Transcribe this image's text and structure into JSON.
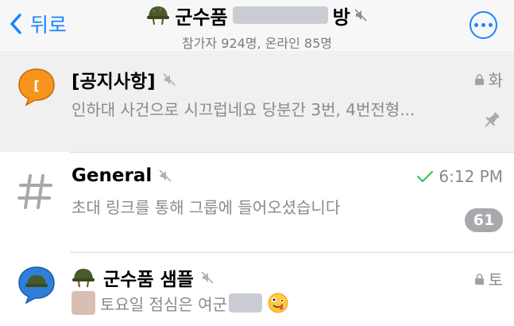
{
  "header": {
    "back_label": "뒤로",
    "title_prefix": "군수품",
    "title_suffix": "방",
    "subtitle": "참가자 924명, 온라인 85명"
  },
  "chats": [
    {
      "name": "[공지사항]",
      "preview": "인하대 사건으로 시끄럽네요 당분간 3번, 4번전형...",
      "time": "화",
      "status": "locked",
      "pinned": true
    },
    {
      "name": "General",
      "preview": "초대 링크를 통해 그룹에 들어오셨습니다",
      "time": "6:12 PM",
      "status": "read",
      "unread_count": "61"
    },
    {
      "name": "군수품 샘플",
      "preview_text": "토요일 점심은 여군",
      "time": "토",
      "status": "locked"
    }
  ],
  "colors": {
    "accent": "#1a84ff",
    "notice_avatar": "#f7941d",
    "read_check": "#34c759",
    "badge": "#a8a8ad"
  },
  "icons": [
    "chevron-left-icon",
    "military-helmet-icon",
    "mute-icon",
    "more-icon",
    "lock-icon",
    "pin-icon",
    "checkmark-icon",
    "hash-icon",
    "zany-face-icon"
  ]
}
